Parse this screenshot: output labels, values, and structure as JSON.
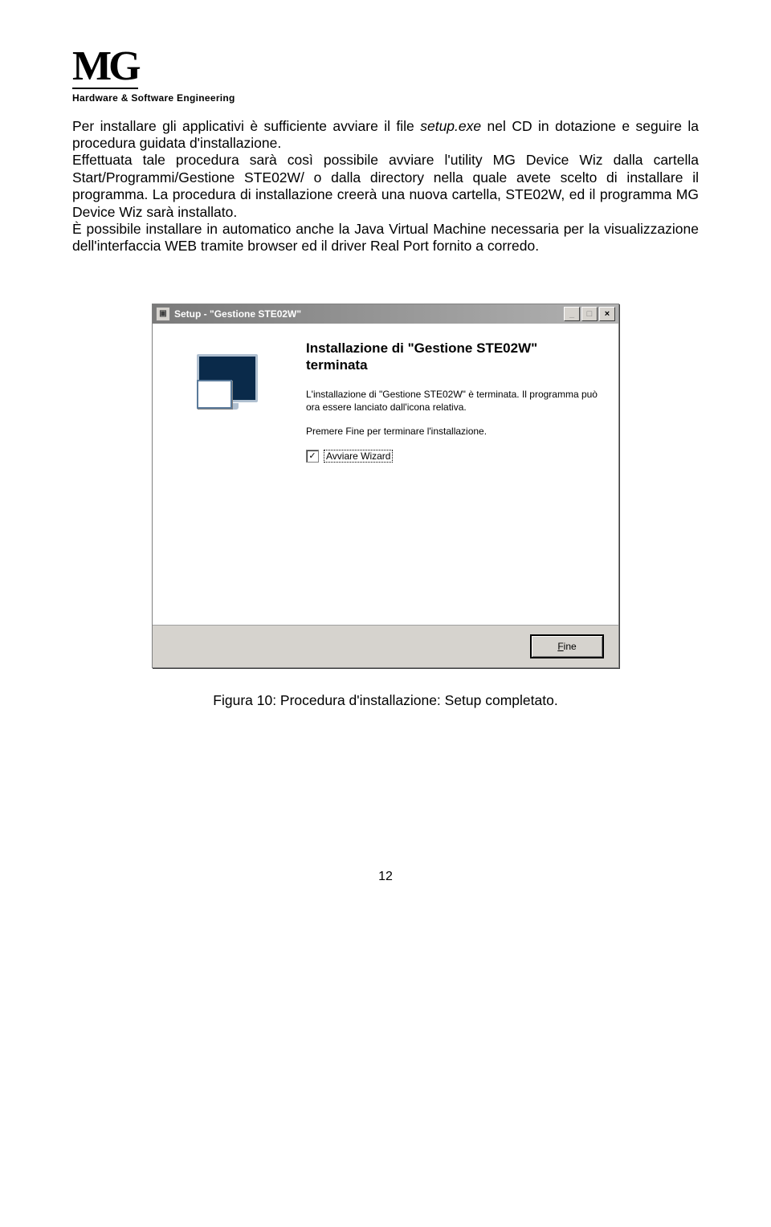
{
  "header": {
    "logo_text": "MG",
    "tagline": "Hardware & Software Engineering"
  },
  "paragraph": {
    "pre": "Per installare gli applicativi è sufficiente avviare il file ",
    "em": "setup.exe",
    "post": " nel CD in dotazione e seguire la procedura guidata d'installazione.",
    "p2": "Effettuata tale procedura sarà così possibile avviare l'utility MG Device Wiz dalla cartella Start/Programmi/Gestione STE02W/ o dalla directory nella quale avete scelto di installare il programma. La procedura di installazione creerà una nuova cartella, STE02W, ed il programma MG Device Wiz sarà installato.",
    "p3": "È possibile installare in automatico anche la Java Virtual Machine necessaria per la visualizzazione dell'interfaccia WEB tramite browser ed il driver Real Port fornito a corredo."
  },
  "installer": {
    "title": "Setup - \"Gestione STE02W\"",
    "heading": "Installazione di \"Gestione STE02W\" terminata",
    "text1": "L'installazione di \"Gestione STE02W\" è terminata. Il programma può ora essere lanciato dall'icona relativa.",
    "text2": "Premere Fine per terminare l'installazione.",
    "checkbox_label": "Avviare Wizard",
    "button_label": "Fine"
  },
  "caption": "Figura 10: Procedura d'installazione: Setup completato.",
  "page_number": "12"
}
